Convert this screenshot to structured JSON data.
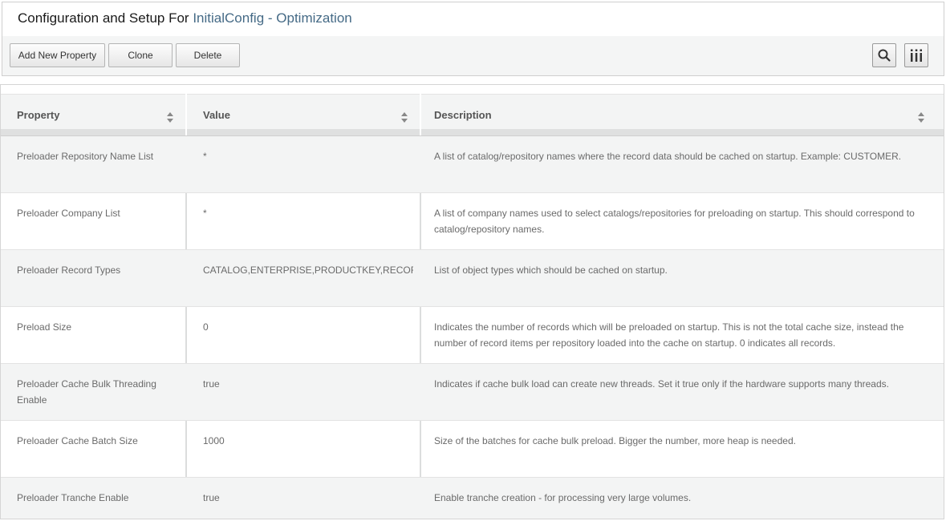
{
  "header": {
    "title_prefix": "Configuration and Setup For",
    "title_config": "InitialConfig - Optimization"
  },
  "toolbar": {
    "add_label": "Add New Property",
    "clone_label": "Clone",
    "delete_label": "Delete",
    "search_icon": "search-icon",
    "columns_icon": "columns-icon"
  },
  "grid": {
    "columns": [
      "Property",
      "Value",
      "Description"
    ],
    "rows": [
      {
        "property": "Preloader Repository Name List",
        "value": "*",
        "description": "A list of catalog/repository names where the record data should be cached on startup. Example: CUSTOMER."
      },
      {
        "property": "Preloader Company List",
        "value": "*",
        "description": "A list of company names used to select catalogs/repositories for preloading on startup. This should correspond to catalog/repository names."
      },
      {
        "property": "Preloader Record Types",
        "value": "CATALOG,ENTERPRISE,PRODUCTKEY,RECORD",
        "description": "List of object types which should be cached on startup."
      },
      {
        "property": "Preload Size",
        "value": "0",
        "description": "Indicates the number of records which will be preloaded on startup. This is not the total cache size, instead the number of record items per repository loaded into the cache on startup. 0 indicates all records."
      },
      {
        "property": "Preloader Cache Bulk Threading Enable",
        "value": "true",
        "description": "Indicates if cache bulk load can create new threads. Set it true only if the hardware supports many threads."
      },
      {
        "property": "Preloader Cache Batch Size",
        "value": "1000",
        "description": "Size of the batches for cache bulk preload. Bigger the number, more heap is needed."
      },
      {
        "property": "Preloader Tranche Enable",
        "value": "true",
        "description": "Enable tranche creation - for processing very large volumes."
      }
    ]
  },
  "colors": {
    "accent": "#456a86",
    "row_alt": "#f3f4f4",
    "header_bg": "#f3f4f4"
  }
}
